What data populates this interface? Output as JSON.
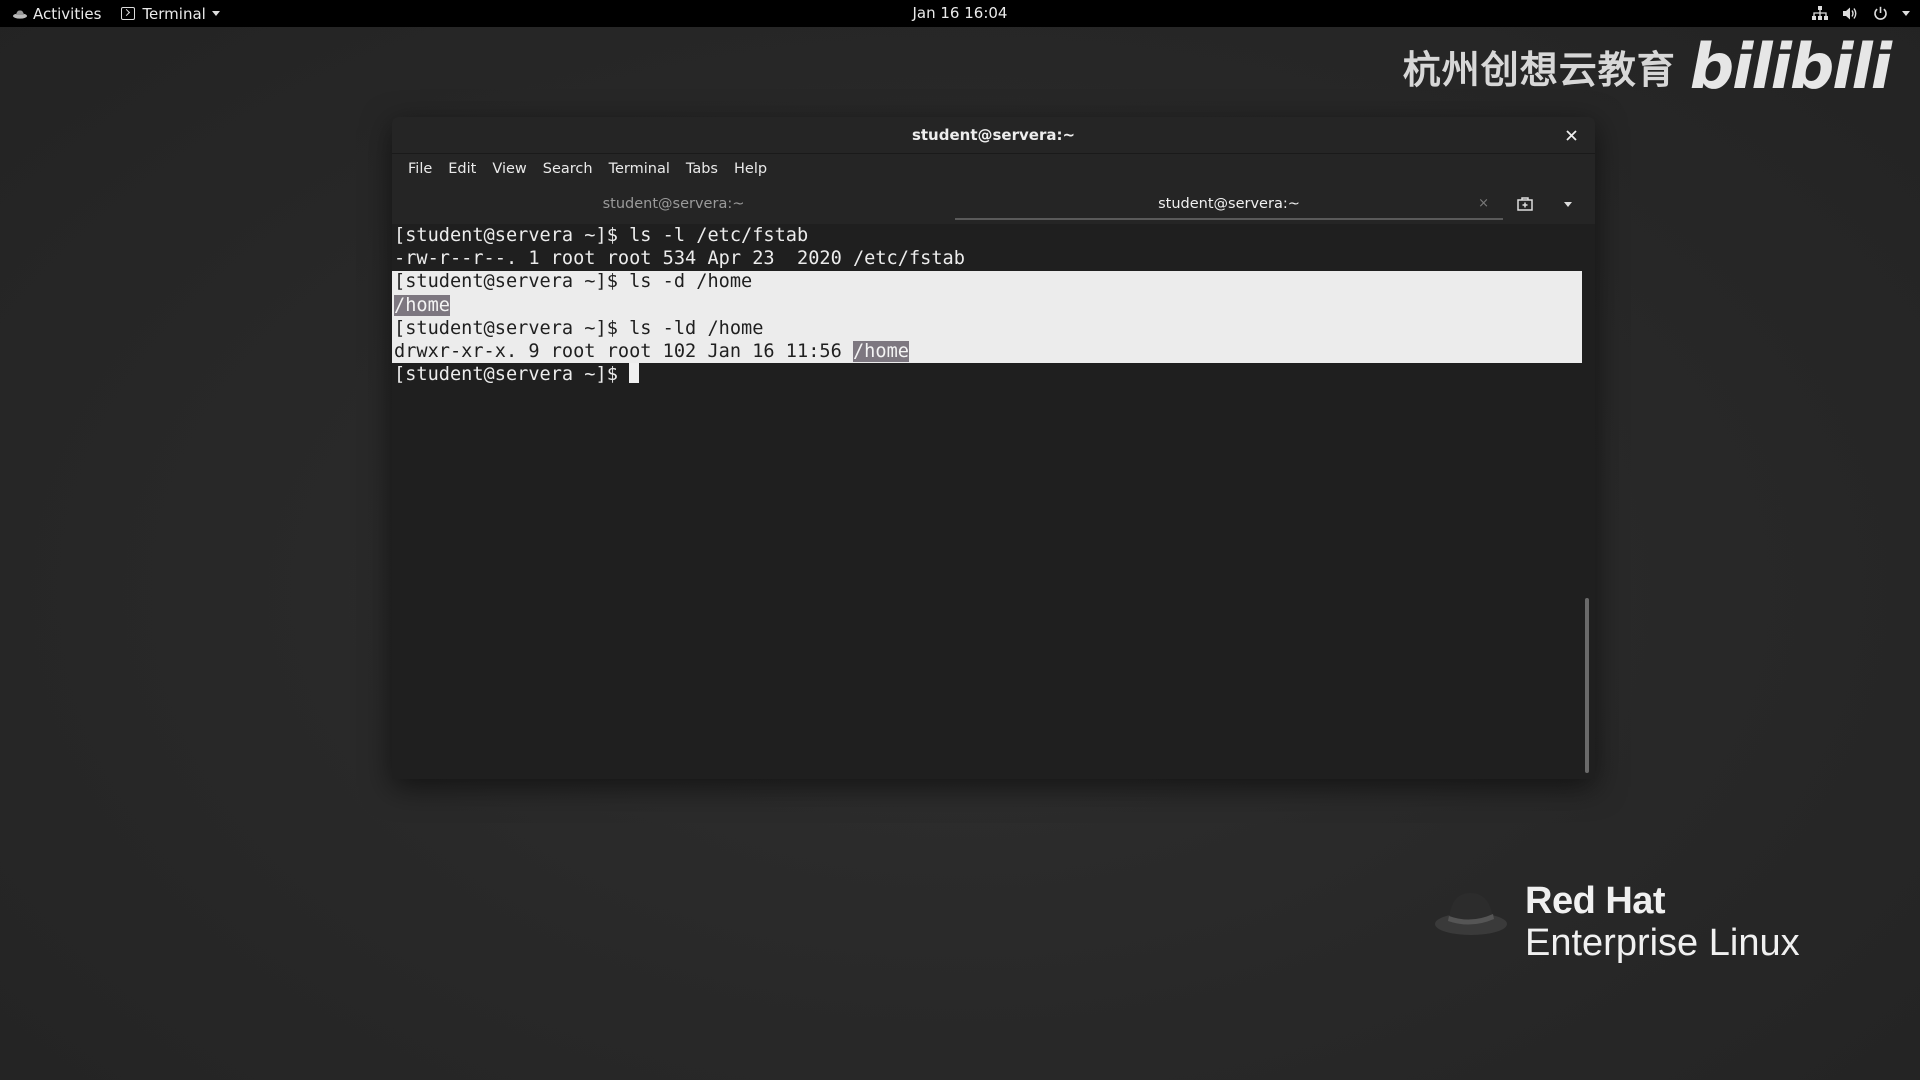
{
  "topbar": {
    "activities": "Activities",
    "app_name": "Terminal",
    "clock": "Jan 16  16:04"
  },
  "watermark": {
    "text": "杭州创想云教育",
    "logo": "bilibili"
  },
  "branding": {
    "line1": "Red Hat",
    "line2": "Enterprise Linux"
  },
  "window": {
    "title": "student@servera:~",
    "close_label": "×"
  },
  "menubar": {
    "items": [
      "File",
      "Edit",
      "View",
      "Search",
      "Terminal",
      "Tabs",
      "Help"
    ]
  },
  "tabs": [
    {
      "label": "student@servera:~",
      "active": false
    },
    {
      "label": "student@servera:~",
      "active": true,
      "close": "×"
    }
  ],
  "terminal": {
    "lines": [
      "[student@servera ~]$ ls -l /etc/fstab",
      "-rw-r--r--. 1 root root 534 Apr 23  2020 /etc/fstab",
      "[student@servera ~]$ ls -d /home",
      "/home",
      "[student@servera ~]$ ls -ld /home",
      "drwxr-xr-x. 9 root root 102 Jan 16 11:56 ",
      "/home",
      "[student@servera ~]$ "
    ]
  },
  "colors": {
    "desktop_bg": "#282828",
    "topbar_bg": "#000000",
    "terminal_bg": "#1f1f1f",
    "selection_bg": "#ececec",
    "highlight_bg": "#7d7780"
  }
}
